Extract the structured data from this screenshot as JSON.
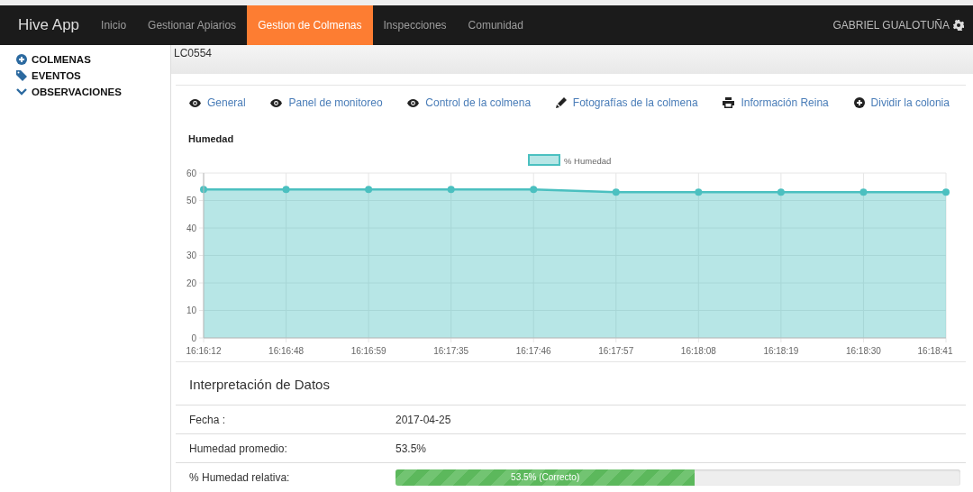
{
  "navbar": {
    "brand": "Hive App",
    "items": [
      {
        "label": "Inicio",
        "selected": false
      },
      {
        "label": "Gestionar Apiarios",
        "selected": false
      },
      {
        "label": "Gestion de Colmenas",
        "selected": true
      },
      {
        "label": "Inspecciones",
        "selected": false
      },
      {
        "label": "Comunidad",
        "selected": false
      }
    ],
    "user": "GABRIEL GUALOTUÑA"
  },
  "sidebar": {
    "items": [
      {
        "label": "COLMENAS",
        "kind": "plus"
      },
      {
        "label": "EVENTOS",
        "kind": "tag"
      },
      {
        "label": "OBSERVACIONES",
        "kind": "chevron"
      }
    ]
  },
  "header": {
    "code": "LC0554"
  },
  "tabs": [
    {
      "label": "General",
      "kind": "eye"
    },
    {
      "label": "Panel de monitoreo",
      "kind": "eye"
    },
    {
      "label": "Control de la colmena",
      "kind": "eye"
    },
    {
      "label": "Fotografías de la colmena",
      "kind": "pencil"
    },
    {
      "label": "Información Reina",
      "kind": "print"
    },
    {
      "label": "Dividir la colonia",
      "kind": "plus"
    }
  ],
  "chart": {
    "title": "Humedad",
    "chart_data": {
      "type": "area",
      "categories": [
        "16:16:12",
        "16:16:48",
        "16:16:59",
        "16:17:35",
        "16:17:46",
        "16:17:57",
        "16:18:08",
        "16:18:19",
        "16:18:30",
        "16:18:41"
      ],
      "series": [
        {
          "name": "% Humedad",
          "color": "#4bc0c0",
          "values": [
            54,
            54,
            54,
            54,
            54,
            53,
            53,
            53,
            53,
            53
          ]
        }
      ],
      "ylim": [
        0,
        60
      ],
      "grid": true,
      "yticks": [
        0,
        10,
        20,
        30,
        40,
        50,
        60
      ]
    }
  },
  "interpretation": {
    "title": "Interpretación de Datos",
    "rows": [
      {
        "label": "Fecha :",
        "value": "2017-04-25"
      },
      {
        "label": "Humedad promedio:",
        "value": "53.5%"
      }
    ],
    "meter": {
      "label": "% Humedad relativa:",
      "level": 0.53,
      "text": "53.5% (Correcto)"
    }
  }
}
